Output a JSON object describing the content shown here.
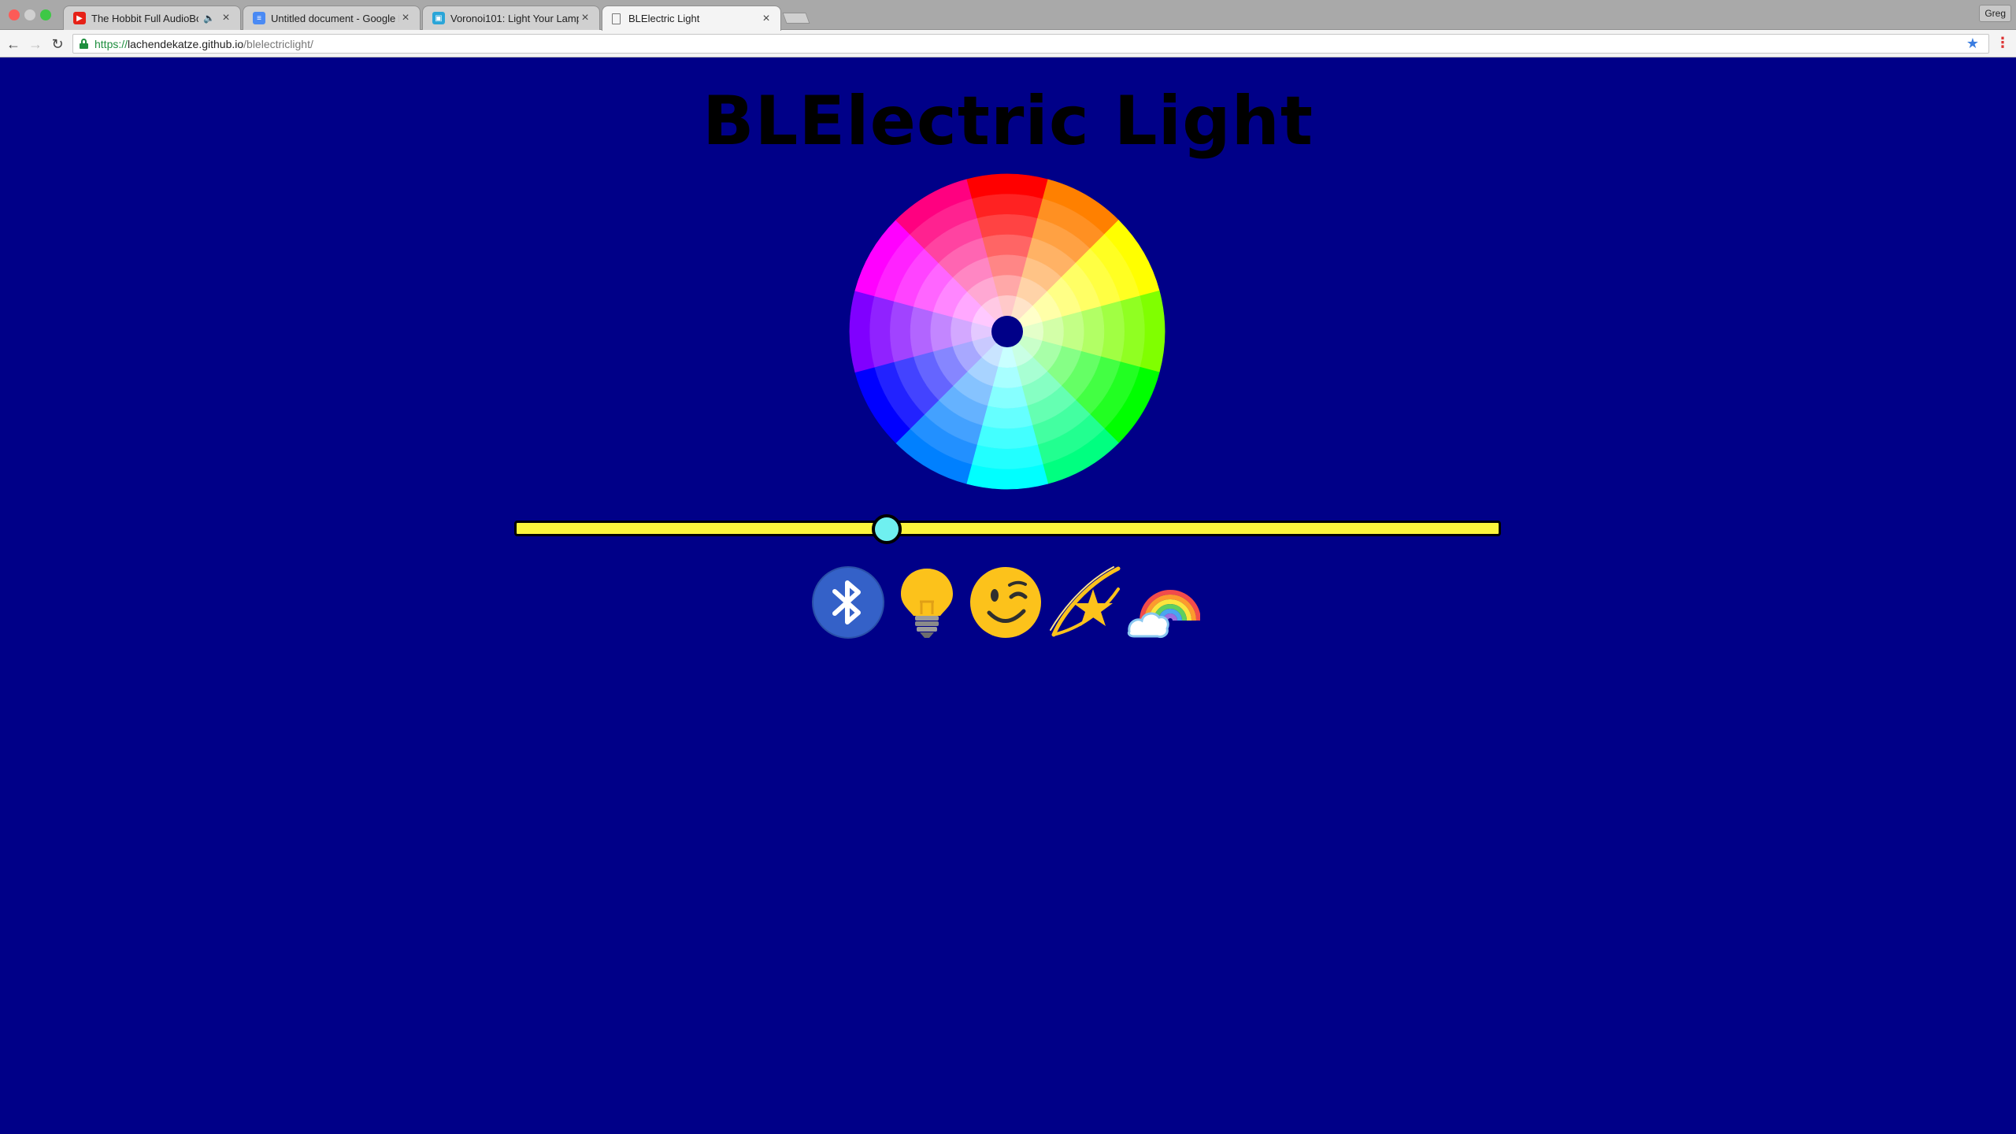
{
  "browser": {
    "tabs": [
      {
        "title": "The Hobbit Full AudioBook",
        "favicon": "youtube-icon",
        "audio": true
      },
      {
        "title": "Untitled document - Google D",
        "favicon": "google-docs-icon",
        "audio": false
      },
      {
        "title": "Voronoi101: Light Your Lamp",
        "favicon": "instructables-icon",
        "audio": false
      },
      {
        "title": "BLElectric Light",
        "favicon": "page-icon",
        "audio": false,
        "active": true
      }
    ],
    "profile": "Greg",
    "url": {
      "scheme": "https://",
      "host": "lachendekatze.github.io",
      "path": "/blelectriclight/"
    }
  },
  "page": {
    "background_color": "#000088",
    "title": "BLElectric Light",
    "slider": {
      "value_fraction": 0.377,
      "track_color": "#fbf53c",
      "thumb_color": "#6ff0f0"
    },
    "color_wheel": {
      "hue_segments": 12,
      "rings": 7,
      "center_color": "#000088"
    },
    "icon_buttons": [
      {
        "name": "bluetooth-icon"
      },
      {
        "name": "lightbulb-icon"
      },
      {
        "name": "winking-face-icon"
      },
      {
        "name": "shooting-star-icon"
      },
      {
        "name": "rainbow-icon"
      }
    ]
  }
}
